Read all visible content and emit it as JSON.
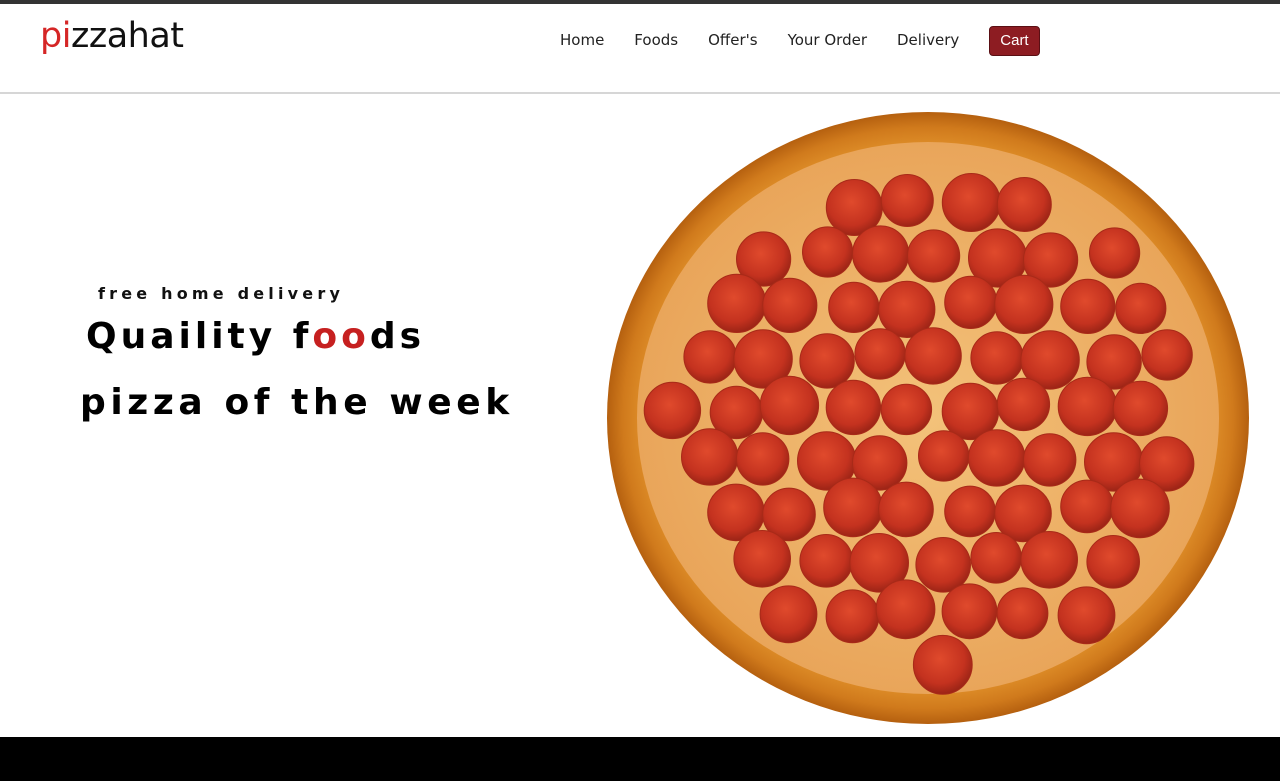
{
  "brand": {
    "logo_accent": "pi",
    "logo_rest": "zzahat",
    "accent_color": "#d52626"
  },
  "nav": {
    "items": [
      {
        "label": "Home"
      },
      {
        "label": "Foods"
      },
      {
        "label": "Offer's"
      },
      {
        "label": "Your Order"
      },
      {
        "label": "Delivery"
      }
    ],
    "cart_label": "Cart",
    "cart_color": "#8d1c22"
  },
  "hero": {
    "tagline": "free home delivery",
    "headline_part1": "Quaility f",
    "headline_accent": "oo",
    "headline_part2": "ds",
    "subheadline": "pizza of the week",
    "image": "pepperoni-pizza"
  },
  "footer": {
    "color": "#000000"
  }
}
